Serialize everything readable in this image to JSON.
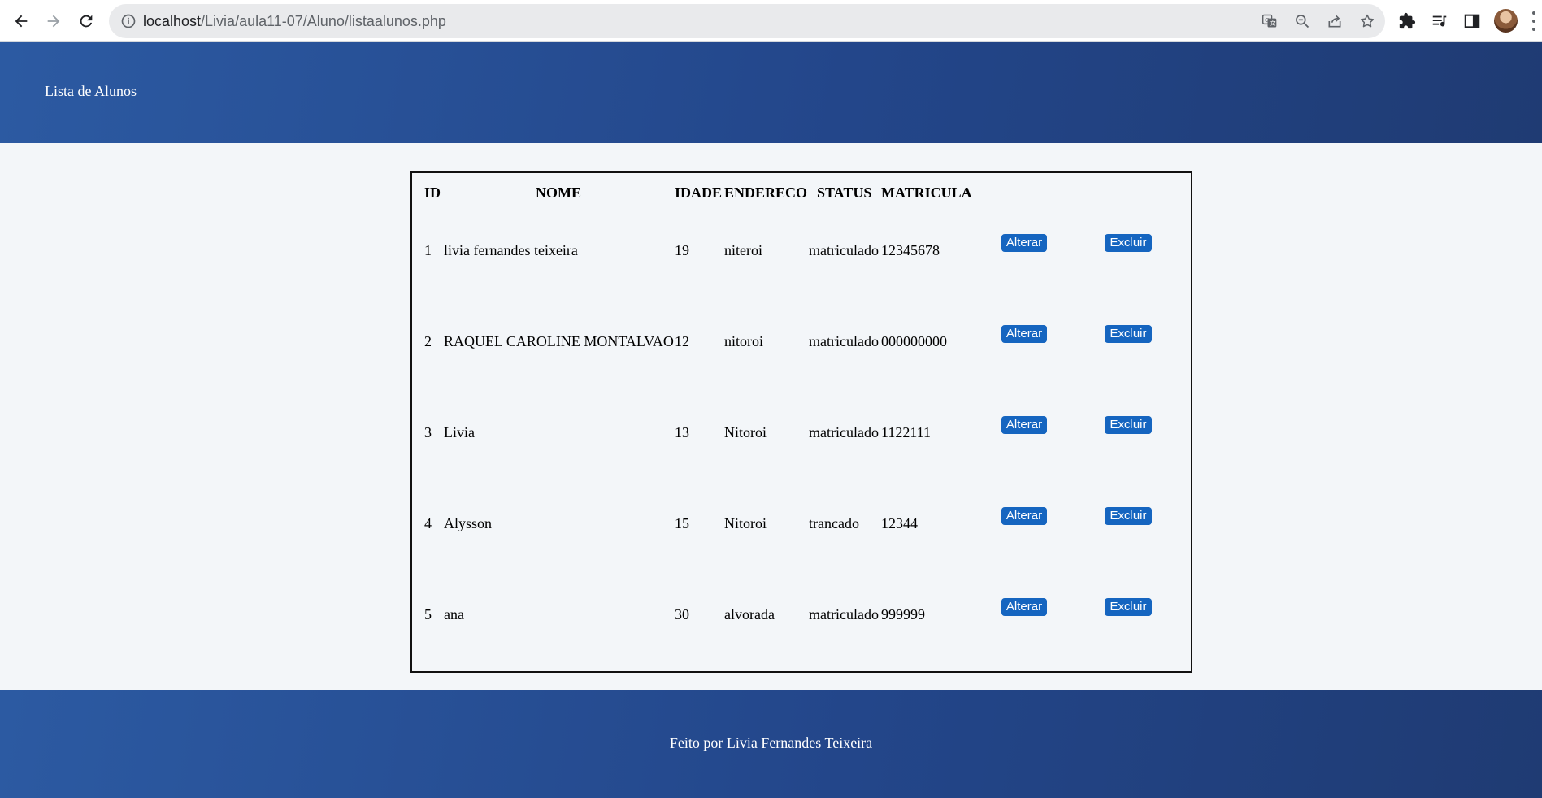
{
  "browser": {
    "url_host": "localhost",
    "url_path": "/Livia/aula11-07/Aluno/listaalunos.php",
    "icons": [
      "back-icon",
      "forward-icon",
      "reload-icon",
      "site-info-icon",
      "translate-icon",
      "zoom-out-icon",
      "share-icon",
      "bookmark-star-icon",
      "extensions-icon",
      "reading-list-icon",
      "side-panel-icon",
      "profile-avatar",
      "menu-kebab-icon"
    ]
  },
  "header": {
    "title": "Lista de Alunos"
  },
  "table": {
    "columns": {
      "id": "ID",
      "nome": "NOME",
      "idade": "IDADE",
      "endereco": "ENDERECO",
      "status": "STATUS",
      "matricula": "MATRICULA"
    },
    "rows": [
      {
        "id": "1",
        "nome": "livia fernandes teixeira",
        "idade": "19",
        "endereco": "niteroi",
        "status": "matriculado",
        "matricula": "12345678",
        "alterar": "Alterar",
        "excluir": "Excluir"
      },
      {
        "id": "2",
        "nome": "RAQUEL CAROLINE MONTALVAO",
        "idade": "12",
        "endereco": "nitoroi",
        "status": "matriculado",
        "matricula": "000000000",
        "alterar": "Alterar",
        "excluir": "Excluir"
      },
      {
        "id": "3",
        "nome": "Livia",
        "idade": "13",
        "endereco": "Nitoroi",
        "status": "matriculado",
        "matricula": "1122111",
        "alterar": "Alterar",
        "excluir": "Excluir"
      },
      {
        "id": "4",
        "nome": "Alysson",
        "idade": "15",
        "endereco": "Nitoroi",
        "status": "trancado",
        "matricula": "12344",
        "alterar": "Alterar",
        "excluir": "Excluir"
      },
      {
        "id": "5",
        "nome": "ana",
        "idade": "30",
        "endereco": "alvorada",
        "status": "matriculado",
        "matricula": "999999",
        "alterar": "Alterar",
        "excluir": "Excluir"
      }
    ]
  },
  "footer": {
    "credit": "Feito por Livia Fernandes Teixeira"
  },
  "colors": {
    "header_gradient_start": "#2c5aa2",
    "header_gradient_end": "#1f3b73",
    "button_blue": "#1565c0",
    "page_background": "#f3f6f9"
  }
}
